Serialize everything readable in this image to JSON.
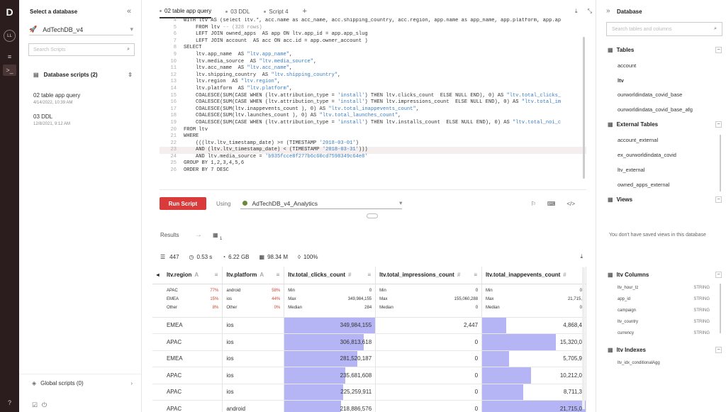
{
  "rail": {
    "logo": "D",
    "avatar": "LL"
  },
  "left": {
    "header": "Select a database",
    "db": "AdTechDB_v4",
    "search_placeholder": "Search Scripts",
    "section": "Database scripts (2)",
    "scripts": [
      {
        "name": "02 table app query",
        "date": "4/14/2022, 10:39 AM"
      },
      {
        "name": "03 DDL",
        "date": "12/8/2021, 9:12 AM"
      }
    ],
    "global": "Global scripts (0)"
  },
  "tabs": [
    {
      "label": "02 table app query",
      "active": true
    },
    {
      "label": "03 DDL"
    },
    {
      "label": "Script 4"
    }
  ],
  "editor": [
    {
      "n": "4",
      "html": "WITH ltv AS (select ltv.*, acc.name as acc_name, acc.shipping_country, acc.region, app.name as app_name, app.platform, app.ap"
    },
    {
      "n": "5",
      "html": "    FROM ltv <span class='c'>-- (328 rows)</span>"
    },
    {
      "n": "6",
      "html": "    LEFT JOIN owned_apps  AS app ON ltv.app_id = app.app_slug"
    },
    {
      "n": "7",
      "html": "    LEFT JOIN account  AS acc ON acc.id = app.owner_account )"
    },
    {
      "n": "8",
      "html": "SELECT"
    },
    {
      "n": "9",
      "html": "    ltv.app_name  AS <span class='s'>\"ltv.app_name\"</span>,"
    },
    {
      "n": "10",
      "html": "    ltv.media_source  AS <span class='s'>\"ltv.media_source\"</span>,"
    },
    {
      "n": "11",
      "html": "    ltv.acc_name  AS <span class='s'>\"ltv.acc_name\"</span>,"
    },
    {
      "n": "12",
      "html": "    ltv.shipping_country  AS <span class='s'>\"ltv.shipping_country\"</span>,"
    },
    {
      "n": "13",
      "html": "    ltv.region  AS <span class='s'>\"ltv.region\"</span>,"
    },
    {
      "n": "14",
      "html": "    ltv.platform  AS <span class='s'>\"ltv.platform\"</span>,"
    },
    {
      "n": "15",
      "html": "    COALESCE(SUM(CASE WHEN (ltv.attribution_type = <span class='s'>'install'</span>) THEN ltv.clicks_count  ELSE NULL END), 0) AS <span class='s'>\"ltv.total_clicks_</span>"
    },
    {
      "n": "16",
      "html": "    COALESCE(SUM(CASE WHEN (ltv.attribution_type = <span class='s'>'install'</span>) THEN ltv.impressions_count  ELSE NULL END), 0) AS <span class='s'>\"ltv.total_im</span>"
    },
    {
      "n": "17",
      "html": "    COALESCE(SUM(ltv.inappevents_count ), 0) AS <span class='s'>\"ltv.total_inappevents_count\"</span>,"
    },
    {
      "n": "18",
      "html": "    COALESCE(SUM(ltv.launches_count ), 0) AS <span class='s'>\"ltv.total_launches_count\"</span>,"
    },
    {
      "n": "19",
      "html": "    COALESCE(SUM(CASE WHEN (ltv.attribution_type = <span class='s'>'install'</span>) THEN ltv.installs_count  ELSE NULL END), 0) AS <span class='s'>\"ltv.total_noi_c</span>"
    },
    {
      "n": "20",
      "html": "FROM ltv"
    },
    {
      "n": "21",
      "html": "WHERE"
    },
    {
      "n": "22",
      "html": "    (((ltv.ltv_timestamp_date) >= (TIMESTAMP <span class='s'>'2018-03-01'</span>)"
    },
    {
      "n": "23",
      "html": "    AND (ltv.ltv_timestamp_date) < (TIMESTAMP <span class='s'>'2018-03-31'</span>)))",
      "hl": true
    },
    {
      "n": "24",
      "html": "    AND ltv.media_source = <span class='s'>'b935fcce8f277b6c60cd7598349c64e8'</span>"
    },
    {
      "n": "25",
      "html": "GROUP BY 1,2,3,4,5,6"
    },
    {
      "n": "26",
      "html": "ORDER BY 7 DESC"
    }
  ],
  "toolbar": {
    "run": "Run Script",
    "using": "Using",
    "db": "AdTechDB_v4_Analytics"
  },
  "results": {
    "label": "Results",
    "count": "1"
  },
  "stats": {
    "rows": "447",
    "time": "0.53 s",
    "size": "6.22 GB",
    "rows2": "98.34 M",
    "pct": "100%"
  },
  "columns": [
    "ltv.region",
    "ltv.platform",
    "ltv.total_clicks_count",
    "ltv.total_impressions_count",
    "ltv.total_inappevents_count"
  ],
  "summary": {
    "region": [
      [
        "APAC",
        "77%"
      ],
      [
        "EMEA",
        "15%"
      ],
      [
        "Other",
        "8%"
      ]
    ],
    "platform": [
      [
        "android",
        "58%"
      ],
      [
        "ios",
        "44%"
      ],
      [
        "Other",
        "0%"
      ]
    ],
    "clicks": [
      [
        "Min",
        "0"
      ],
      [
        "Max",
        "349,984,155"
      ],
      [
        "Median",
        "284"
      ]
    ],
    "impr": [
      [
        "Min",
        "0"
      ],
      [
        "Max",
        "155,060,288"
      ],
      [
        "Median",
        "0"
      ]
    ],
    "inapp": [
      [
        "Min",
        "0"
      ],
      [
        "Max",
        "21,715,"
      ],
      [
        "Median",
        "0"
      ]
    ]
  },
  "rows": [
    {
      "region": "EMEA",
      "platform": "ios",
      "clicks": "349,984,155",
      "cf": 1.0,
      "impr": "2,447",
      "inapp": "4,868,4",
      "if": 0.23
    },
    {
      "region": "APAC",
      "platform": "ios",
      "clicks": "306,813,618",
      "cf": 0.877,
      "impr": "0",
      "inapp": "15,320,0",
      "if": 0.71
    },
    {
      "region": "EMEA",
      "platform": "ios",
      "clicks": "281,520,187",
      "cf": 0.804,
      "impr": "0",
      "inapp": "5,705,9",
      "if": 0.26
    },
    {
      "region": "APAC",
      "platform": "ios",
      "clicks": "235,681,608",
      "cf": 0.673,
      "impr": "0",
      "inapp": "10,212,0",
      "if": 0.47
    },
    {
      "region": "APAC",
      "platform": "ios",
      "clicks": "225,259,911",
      "cf": 0.644,
      "impr": "0",
      "inapp": "8,711,3",
      "if": 0.4
    },
    {
      "region": "APAC",
      "platform": "android",
      "clicks": "218,886,576",
      "cf": 0.625,
      "impr": "0",
      "inapp": "21,715,0",
      "if": 1.0
    }
  ],
  "right": {
    "header": "Database",
    "search_placeholder": "Search tables and columns",
    "tables_h": "Tables",
    "tables": [
      "account",
      "ltv",
      "ourworldindata_covid_base",
      "ourworldindata_covid_base_afg"
    ],
    "ext_h": "External Tables",
    "ext": [
      "account_external",
      "ex_ourworldindata_covid",
      "ltv_external",
      "owned_apps_external"
    ],
    "views_h": "Views",
    "views_empty": "You don't have saved views in this database",
    "cols_h": "ltv Columns",
    "cols": [
      [
        "ltv_hour_tz",
        "STRING"
      ],
      [
        "app_id",
        "STRING"
      ],
      [
        "campaign",
        "STRING"
      ],
      [
        "ltv_country",
        "STRING"
      ],
      [
        "currency",
        "STRING"
      ]
    ],
    "idx_h": "ltv Indexes",
    "idx": [
      "ltv_idx_conditionalAgg"
    ]
  }
}
